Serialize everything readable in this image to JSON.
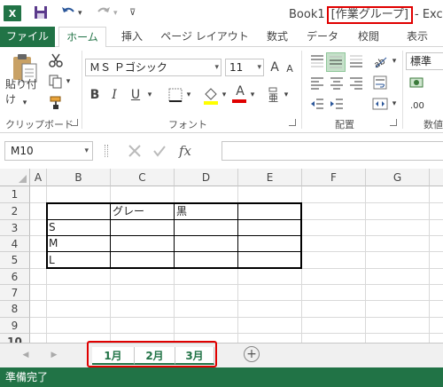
{
  "window": {
    "app_logo": "X",
    "title_prefix": "Book1",
    "title_group": "[作業グループ]",
    "title_suffix": "- Excel"
  },
  "ribbon_tabs": [
    "ファイル",
    "ホーム",
    "挿入",
    "ページ レイアウト",
    "数式",
    "データ",
    "校閲",
    "表示"
  ],
  "ribbon": {
    "paste_label": "貼り付け",
    "font_name": "ＭＳ Ｐゴシック",
    "font_size": "11",
    "style_combo": "標準",
    "groups": {
      "clipboard": "クリップボード",
      "font": "フォント",
      "alignment": "配置",
      "number": "数値"
    },
    "bold": "B",
    "italic": "I",
    "underline": "U",
    "font_color_glyph": "A",
    "grow_font": "A",
    "shrink_font": "A"
  },
  "formula_bar": {
    "name_box": "M10",
    "fx": "fx",
    "value": ""
  },
  "grid": {
    "columns": [
      "A",
      "B",
      "C",
      "D",
      "E",
      "F",
      "G"
    ],
    "rows": [
      "1",
      "2",
      "3",
      "4",
      "5",
      "6",
      "7",
      "8",
      "9",
      "10"
    ],
    "cells": {
      "C2": "グレー",
      "D2": "黒",
      "B3": "S",
      "B4": "M",
      "B5": "L"
    }
  },
  "sheets": {
    "tabs": [
      "1月",
      "2月",
      "3月"
    ],
    "add_symbol": "+"
  },
  "status": {
    "text": "準備完了"
  },
  "colors": {
    "accent": "#217346",
    "highlight": "#e00000"
  }
}
